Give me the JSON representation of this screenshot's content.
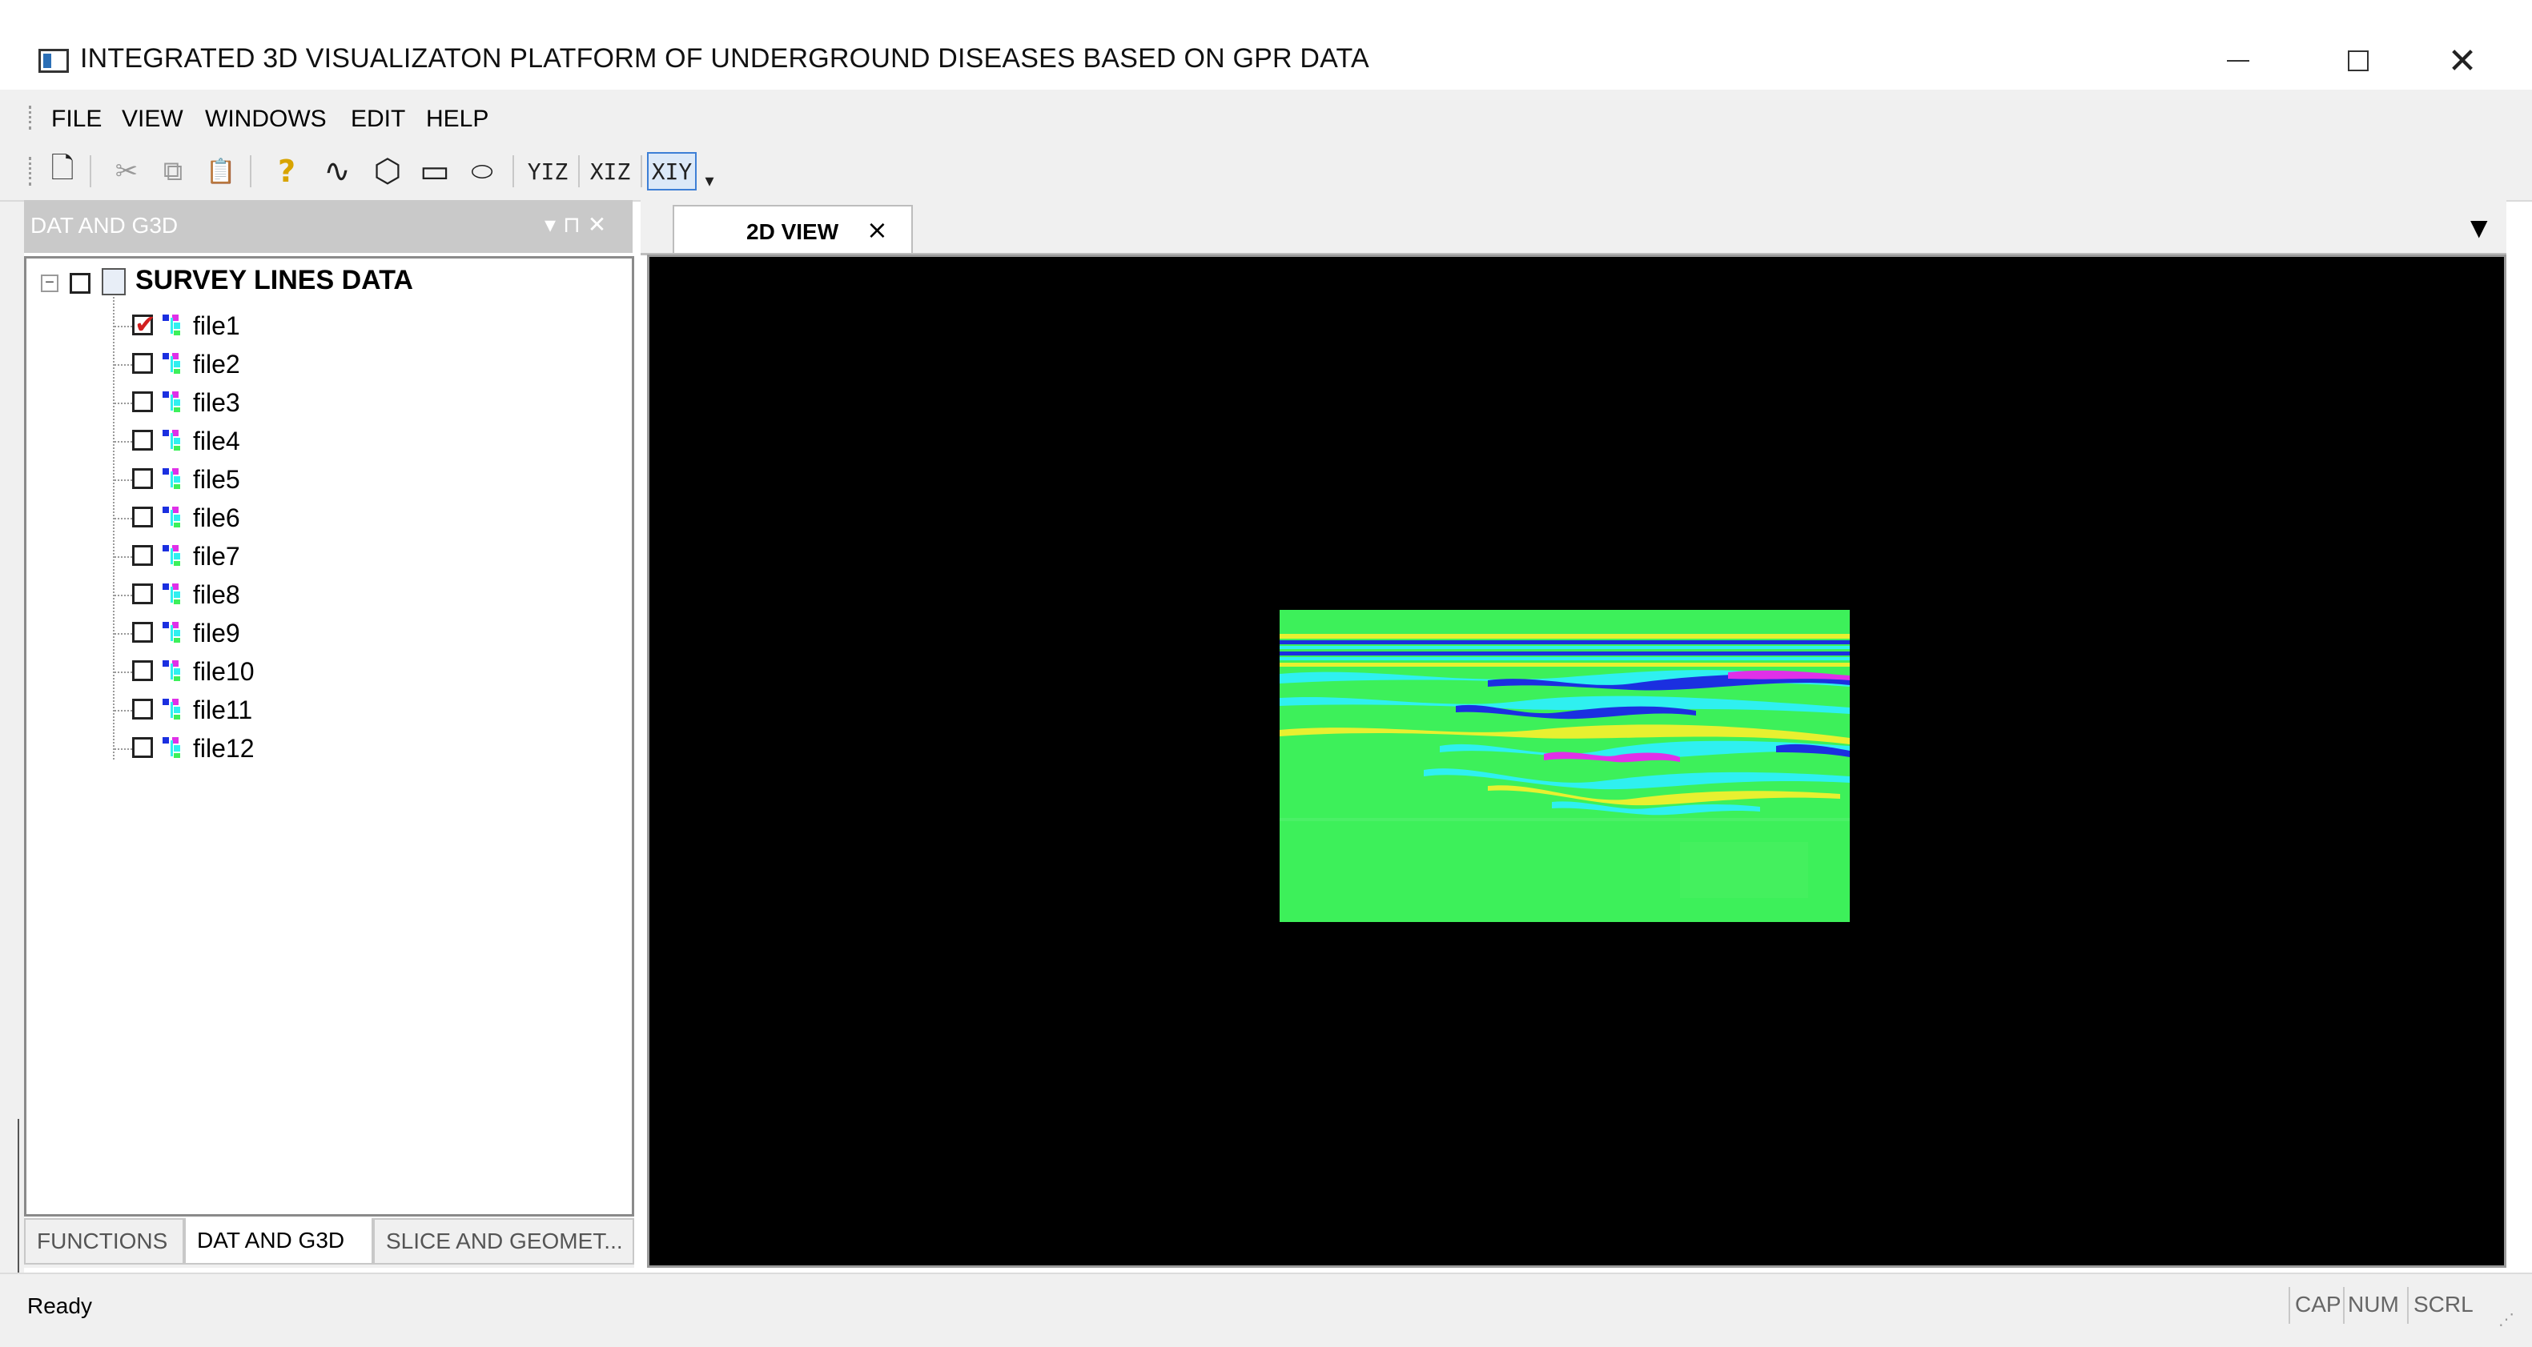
{
  "window": {
    "title": "INTEGRATED 3D VISUALIZATON PLATFORM OF UNDERGROUND DISEASES BASED ON GPR DATA",
    "minimize_glyph": "–",
    "maximize_glyph": "☐",
    "close_glyph": "✕"
  },
  "menu": {
    "items": [
      {
        "label": "FILE"
      },
      {
        "label": "VIEW"
      },
      {
        "label": "WINDOWS"
      },
      {
        "label": "EDIT"
      },
      {
        "label": "HELP"
      }
    ]
  },
  "toolbar": {
    "buttons": [
      {
        "name": "new-document-icon",
        "glyph": "🗋"
      },
      {
        "name": "cut-icon",
        "glyph": "✂"
      },
      {
        "name": "copy-icon",
        "glyph": "⧉"
      },
      {
        "name": "paste-icon",
        "glyph": "📋"
      },
      {
        "name": "help-icon",
        "glyph": "?"
      },
      {
        "name": "wave-icon",
        "glyph": "∿"
      },
      {
        "name": "polygon-icon",
        "glyph": "⬡"
      },
      {
        "name": "rounded-rect-icon",
        "glyph": "▭"
      },
      {
        "name": "ellipse-icon",
        "glyph": "⬭"
      }
    ],
    "text_buttons": [
      {
        "name": "yiz-button",
        "label": "YIZ"
      },
      {
        "name": "xiz-button",
        "label": "XIZ"
      },
      {
        "name": "xiy-button",
        "label": "XIY"
      }
    ],
    "overflow_glyph": "▾"
  },
  "dock": {
    "title": "DAT AND G3D",
    "pin_glyph": "▾ ⊓ ✕"
  },
  "tree": {
    "root_label": "SURVEY LINES DATA",
    "root_expander": "−",
    "files": [
      {
        "label": "file1",
        "checked": true
      },
      {
        "label": "file2",
        "checked": false
      },
      {
        "label": "file3",
        "checked": false
      },
      {
        "label": "file4",
        "checked": false
      },
      {
        "label": "file5",
        "checked": false
      },
      {
        "label": "file6",
        "checked": false
      },
      {
        "label": "file7",
        "checked": false
      },
      {
        "label": "file8",
        "checked": false
      },
      {
        "label": "file9",
        "checked": false
      },
      {
        "label": "file10",
        "checked": false
      },
      {
        "label": "file11",
        "checked": false
      },
      {
        "label": "file12",
        "checked": false
      }
    ]
  },
  "bottom_tabs": [
    {
      "label": "FUNCTIONS",
      "active": false
    },
    {
      "label": "DAT AND G3D",
      "active": true
    },
    {
      "label": "SLICE AND GEOMET...",
      "active": false
    }
  ],
  "view": {
    "tab_label": "2D VIEW",
    "tab_close": "×",
    "dropdown_glyph": "▼"
  },
  "statusbar": {
    "text": "Ready",
    "indicators": [
      "CAP",
      "NUM",
      "SCRL"
    ]
  },
  "colors": {
    "gpr_background": "#3df05a",
    "gpr_cyan": "#2ff0f0",
    "gpr_blue": "#1b2fe0",
    "gpr_magenta": "#e030e8",
    "gpr_yellow": "#e8f030",
    "viewport_bg": "#000000"
  }
}
